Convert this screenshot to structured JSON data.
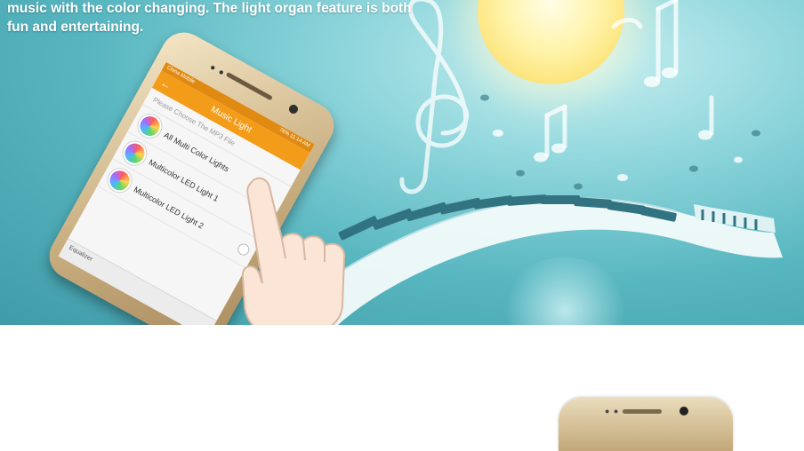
{
  "banner": {
    "intro_text": "music with the color changing. The light organ feature is both fun and entertaining."
  },
  "phone": {
    "status_bar": {
      "carrier": "China Mobile",
      "battery": "76%",
      "time": "11:14 AM"
    },
    "app_bar": {
      "title": "Music Light",
      "back_icon": "arrow-left-icon"
    },
    "prompt": "Please Choose The MP3 File",
    "lights": [
      {
        "label": "All Multi Color Lights",
        "selected": false
      },
      {
        "label": "Multicolor LED Light 1",
        "selected": true
      },
      {
        "label": "Multicolor LED Light 2",
        "selected": false
      }
    ],
    "nav": {
      "equalizer_label": "Equalizer"
    }
  },
  "colors": {
    "accent_orange": "#f39c19",
    "banner_teal": "#57b6c0",
    "radio_blue": "#2e82e8"
  }
}
